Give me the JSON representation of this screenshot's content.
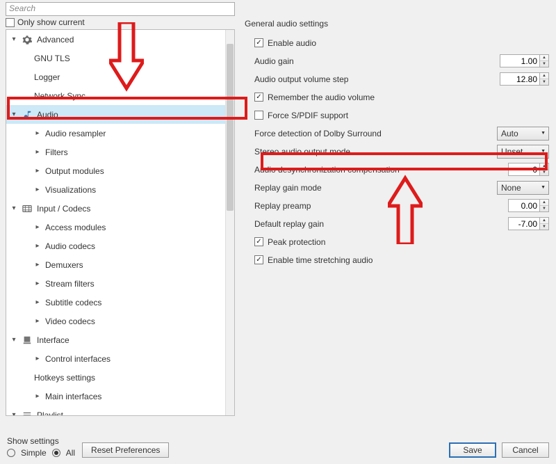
{
  "search": {
    "placeholder": "Search"
  },
  "only_show_current": "Only show current",
  "tree": {
    "advanced": "Advanced",
    "gnu_tls": "GNU TLS",
    "logger": "Logger",
    "network_sync": "Network Sync",
    "audio": "Audio",
    "audio_resampler": "Audio resampler",
    "filters": "Filters",
    "output_modules": "Output modules",
    "visualizations": "Visualizations",
    "input_codecs": "Input / Codecs",
    "access_modules": "Access modules",
    "audio_codecs": "Audio codecs",
    "demuxers": "Demuxers",
    "stream_filters": "Stream filters",
    "subtitle_codecs": "Subtitle codecs",
    "video_codecs": "Video codecs",
    "interface": "Interface",
    "control_interfaces": "Control interfaces",
    "hotkeys_settings": "Hotkeys settings",
    "main_interfaces": "Main interfaces",
    "playlist": "Playlist"
  },
  "right": {
    "title": "General audio settings",
    "enable_audio": "Enable audio",
    "audio_gain": {
      "label": "Audio gain",
      "value": "1.00"
    },
    "volume_step": {
      "label": "Audio output volume step",
      "value": "12.80"
    },
    "remember_volume": "Remember the audio volume",
    "force_spdif": "Force S/PDIF support",
    "force_dolby": {
      "label": "Force detection of Dolby Surround",
      "value": "Auto"
    },
    "stereo_mode": {
      "label": "Stereo audio output mode",
      "value": "Unset"
    },
    "desync": {
      "label": "Audio desynchronization compensation",
      "value": "0"
    },
    "replay_mode": {
      "label": "Replay gain mode",
      "value": "None"
    },
    "replay_preamp": {
      "label": "Replay preamp",
      "value": "0.00"
    },
    "default_replay": {
      "label": "Default replay gain",
      "value": "-7.00"
    },
    "peak_protection": "Peak protection",
    "time_stretch": "Enable time stretching audio"
  },
  "footer": {
    "show_settings": "Show settings",
    "simple": "Simple",
    "all": "All",
    "reset": "Reset Preferences",
    "save": "Save",
    "cancel": "Cancel"
  }
}
